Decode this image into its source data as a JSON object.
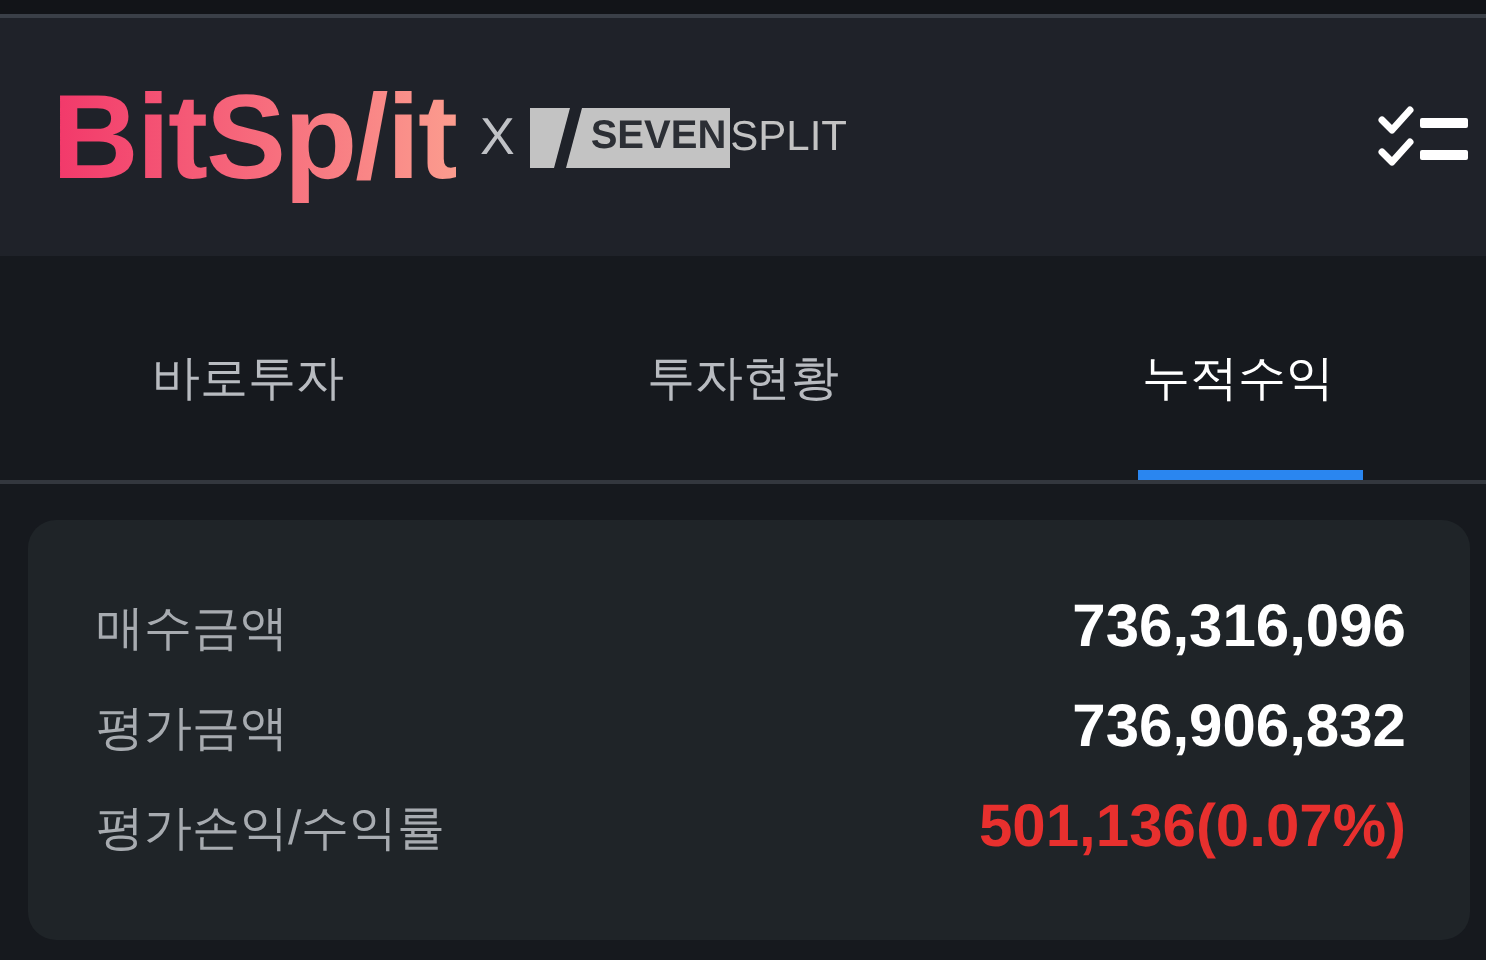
{
  "header": {
    "logo": "BitSp/it",
    "separator": "X",
    "partner_badge": "SEVEN",
    "partner_text": "SPLIT"
  },
  "tabs": [
    {
      "label": "바로투자",
      "selected": false
    },
    {
      "label": "투자현황",
      "selected": false
    },
    {
      "label": "누적수익",
      "selected": true
    }
  ],
  "summary": [
    {
      "label": "매수금액",
      "value": "736,316,096",
      "kind": "plain"
    },
    {
      "label": "평가금액",
      "value": "736,906,832",
      "kind": "plain"
    },
    {
      "label": "평가손익/수익률",
      "value": "501,136(0.07%)",
      "kind": "gain"
    }
  ]
}
